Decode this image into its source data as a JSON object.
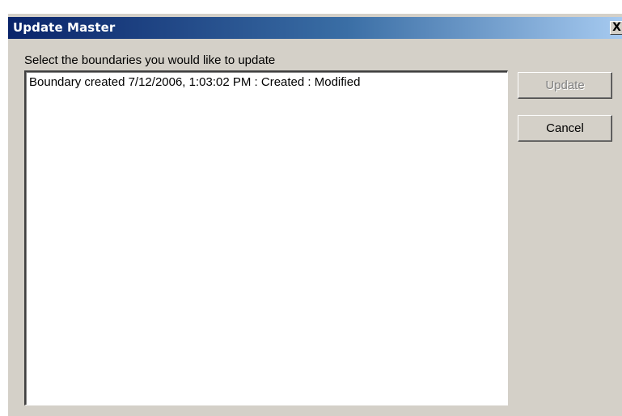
{
  "window": {
    "title": "Update Master",
    "close_glyph": "X"
  },
  "prompt": "Select the boundaries you would like to update",
  "boundaries": [
    "Boundary created 7/12/2006, 1:03:02 PM : Created : Modified"
  ],
  "buttons": {
    "update_label": "Update",
    "cancel_label": "Cancel"
  },
  "colors": {
    "title_bar_start": "#0a246a",
    "title_bar_end": "#a6caf0",
    "dialog_face": "#d4d0c8",
    "list_background": "#ffffff"
  },
  "icons": {
    "close": "close-icon"
  }
}
